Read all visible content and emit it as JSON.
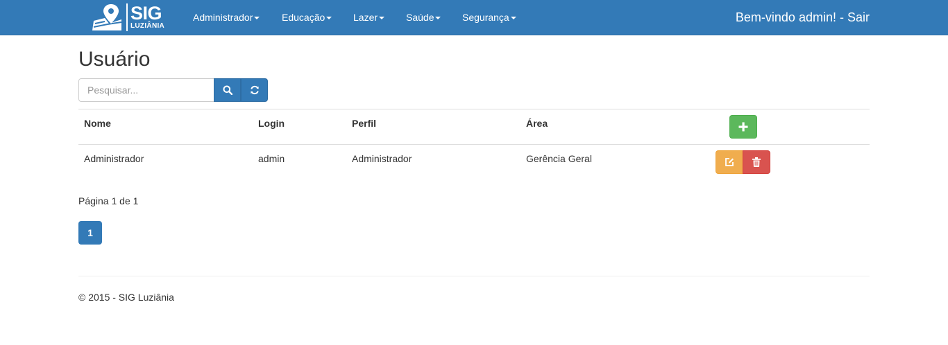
{
  "brand": {
    "title": "SIG",
    "subtitle": "LUZIÂNIA"
  },
  "nav": {
    "items": [
      {
        "label": "Administrador"
      },
      {
        "label": "Educação"
      },
      {
        "label": "Lazer"
      },
      {
        "label": "Saúde"
      },
      {
        "label": "Segurança"
      }
    ],
    "welcome": "Bem-vindo admin!",
    "separator": " - ",
    "logout": "Sair"
  },
  "page": {
    "title": "Usuário"
  },
  "search": {
    "placeholder": "Pesquisar...",
    "value": ""
  },
  "table": {
    "headers": [
      "Nome",
      "Login",
      "Perfil",
      "Área"
    ],
    "rows": [
      {
        "nome": "Administrador",
        "login": "admin",
        "perfil": "Administrador",
        "area": "Gerência Geral"
      }
    ]
  },
  "pagination": {
    "info": "Página 1 de 1",
    "current": "1"
  },
  "footer": {
    "text": "© 2015 - SIG Luziânia"
  },
  "colors": {
    "primary": "#337ab7",
    "success": "#5cb85c",
    "warning": "#f0ad4e",
    "danger": "#d9534f"
  },
  "icons": {
    "search": "search-icon",
    "refresh": "refresh-icon",
    "add": "plus-icon",
    "edit": "edit-icon",
    "delete": "trash-icon",
    "logo": "map-pin-icon"
  }
}
